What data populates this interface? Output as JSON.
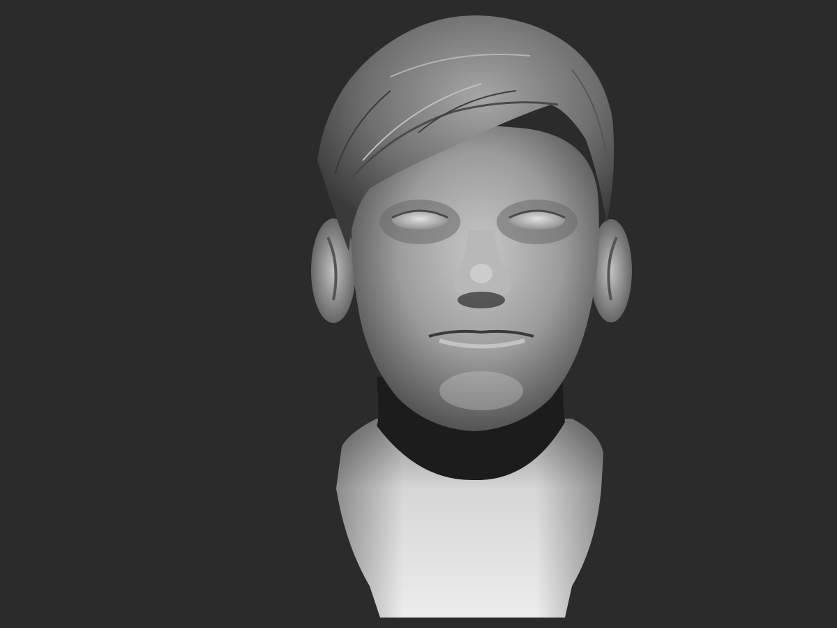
{
  "scene": {
    "background_color": "#2b2b2b",
    "subject": "sculpt-head-bust",
    "material_color": "#9a9a9a"
  }
}
